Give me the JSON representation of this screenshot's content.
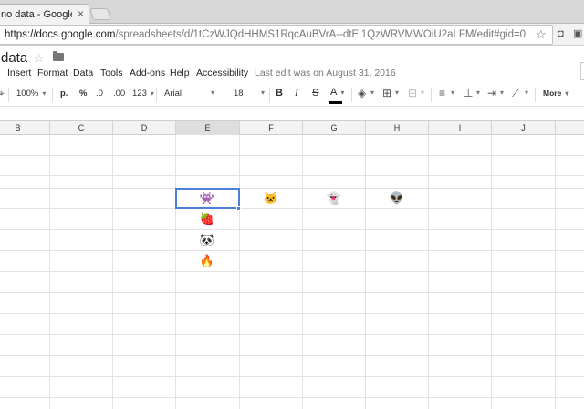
{
  "browser": {
    "tab_title": "no data - Google Sh",
    "tab_close": "×",
    "url_host": "https://docs.google.com",
    "url_path": "/spreadsheets/d/1tCzWJQdHHMS1RqcAuBVrA--dtEl1QzWRVMWOiU2aLFM/edit#gid=0",
    "icons": [
      "star-icon",
      "camera-icon",
      "extension-icon"
    ]
  },
  "doc": {
    "title": "data",
    "last_edit": "Last edit was on August 31, 2016"
  },
  "menu": [
    "Insert",
    "Format",
    "Data",
    "Tools",
    "Add-ons",
    "Help",
    "Accessibility"
  ],
  "toolbar": {
    "zoom": "100%",
    "currency": "p.",
    "percent": "%",
    "decimal_decrease": ".0",
    "decimal_increase": ".00",
    "more_formats": "123",
    "font": "Arial",
    "font_size": "18",
    "bold": "B",
    "italic": "I",
    "strike": "S",
    "text_color": "A",
    "more": "More"
  },
  "grid": {
    "columns": [
      "B",
      "C",
      "D",
      "E",
      "F",
      "G",
      "H",
      "I",
      "J"
    ],
    "selected_column": "E",
    "selected_cell": "E5",
    "cells": [
      {
        "col": "E",
        "row": 5,
        "value": "👾"
      },
      {
        "col": "F",
        "row": 5,
        "value": "🐱"
      },
      {
        "col": "G",
        "row": 5,
        "value": "👻"
      },
      {
        "col": "H",
        "row": 5,
        "value": "👽"
      },
      {
        "col": "E",
        "row": 6,
        "value": "🍓"
      },
      {
        "col": "E",
        "row": 7,
        "value": "🐼"
      },
      {
        "col": "E",
        "row": 8,
        "value": "🔥"
      }
    ]
  },
  "colors": {
    "selection": "#4d7fd8",
    "header_bg": "#f3f3f3",
    "grid_line": "#e2e2e2"
  }
}
